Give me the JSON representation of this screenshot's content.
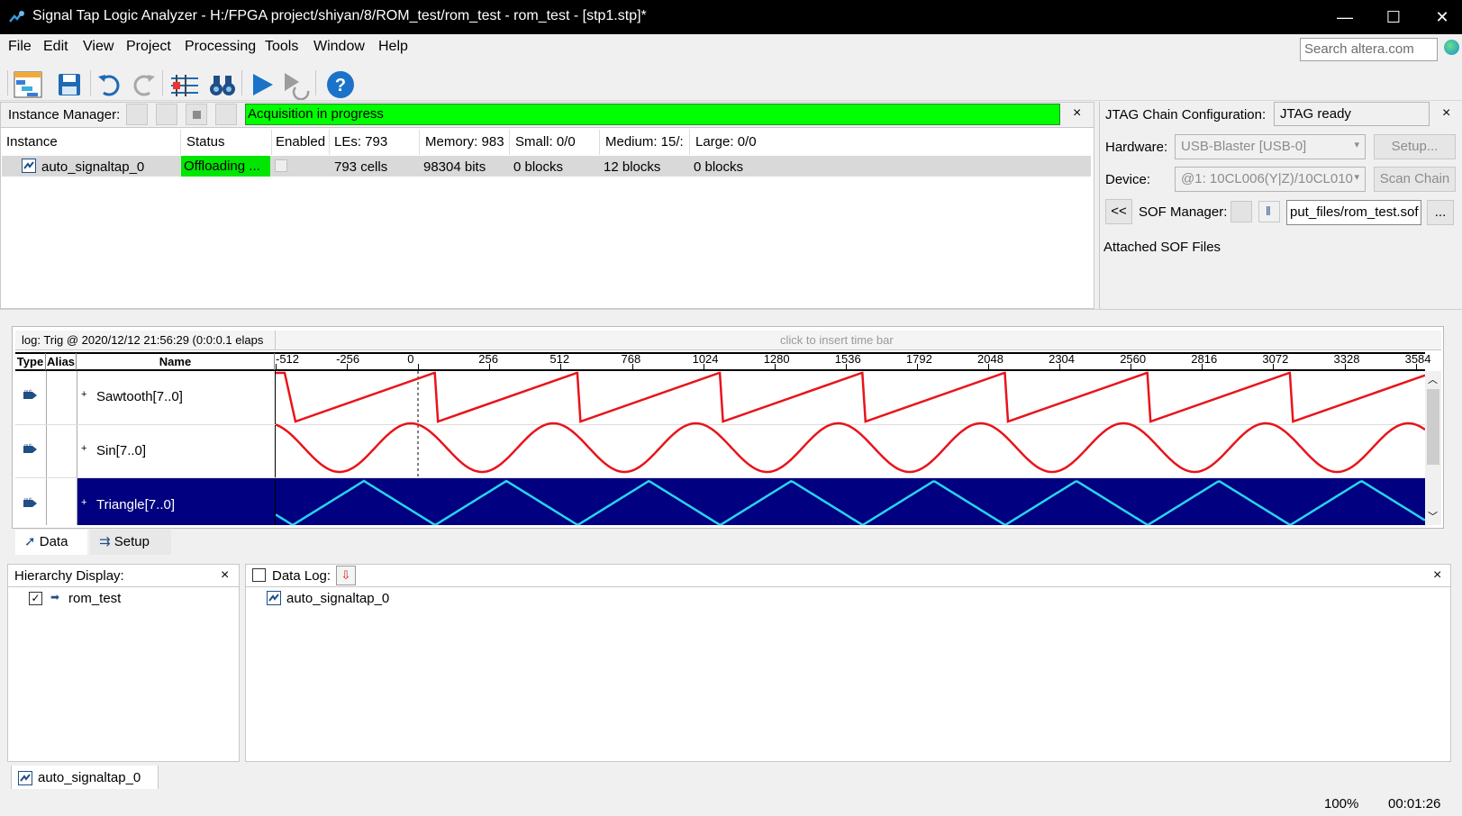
{
  "window": {
    "title": "Signal Tap Logic Analyzer - H:/FPGA project/shiyan/8/ROM_test/rom_test - rom_test - [stp1.stp]*",
    "minimize": "—",
    "maximize": "☐",
    "close": "✕"
  },
  "menu": {
    "items": [
      "File",
      "Edit",
      "View",
      "Project",
      "Processing",
      "Tools",
      "Window",
      "Help"
    ],
    "search_placeholder": "Search altera.com"
  },
  "toolbar": {
    "icons": [
      "hierarchy-icon",
      "save-icon",
      "undo-icon",
      "redo-icon",
      "node-finder-icon",
      "binoculars-icon",
      "run-analysis-icon",
      "autorun-icon",
      "help-icon"
    ]
  },
  "instance_manager": {
    "label": "Instance Manager:",
    "status_text": "Acquisition in progress",
    "status_color": "#00ff00",
    "close": "×",
    "columns": [
      "Instance",
      "Status",
      "Enabled",
      "LEs: 793",
      "Memory: 983",
      "Small: 0/0",
      "Medium: 15/:",
      "Large: 0/0"
    ],
    "rows": [
      {
        "instance": "auto_signaltap_0",
        "status": "Offloading ...",
        "les": "793 cells",
        "memory": "98304 bits",
        "small": "0 blocks",
        "medium": "12 blocks",
        "large": "0 blocks"
      }
    ]
  },
  "jtag": {
    "label": "JTAG Chain Configuration:",
    "status": "JTAG ready",
    "close": "×",
    "hardware_label": "Hardware:",
    "hardware_value": "USB-Blaster [USB-0]",
    "setup_button": "Setup...",
    "device_label": "Device:",
    "device_value": "@1: 10CL006(Y|Z)/10CL010",
    "scan_chain_button": "Scan Chain",
    "collapse_button": "<<",
    "sof_label": "SOF Manager:",
    "sof_value": "put_files/rom_test.sof",
    "browse_button": "...",
    "attached_label": "Attached SOF Files"
  },
  "waveform": {
    "log_label": "log: Trig @ 2020/12/12 21:56:29 (0:0:0.1 elaps",
    "timebar_hint": "click to insert time bar",
    "headers": {
      "type": "Type",
      "alias": "Alias",
      "name": "Name"
    },
    "ticks": [
      "-512",
      "-256",
      "0",
      "256",
      "512",
      "768",
      "1024",
      "1280",
      "1536",
      "1792",
      "2048",
      "2304",
      "2560",
      "2816",
      "3072",
      "3328",
      "3584"
    ],
    "signals": [
      {
        "name": "Sawtooth[7..0]",
        "expand": "+"
      },
      {
        "name": "Sin[7..0]",
        "expand": "+"
      },
      {
        "name": "Triangle[7..0]",
        "expand": "+"
      }
    ],
    "wave_color": "#e8141a",
    "selected_wave_color": "#27d4f0",
    "selected_bg": "#000080"
  },
  "view_tabs": {
    "data": "Data",
    "setup": "Setup"
  },
  "hierarchy": {
    "label": "Hierarchy Display:",
    "close": "×",
    "item": "rom_test"
  },
  "datalog": {
    "label": "Data Log:",
    "close": "×",
    "item": "auto_signaltap_0"
  },
  "instance_tab": "auto_signaltap_0",
  "status": {
    "zoom": "100%",
    "elapsed": "00:01:26"
  }
}
